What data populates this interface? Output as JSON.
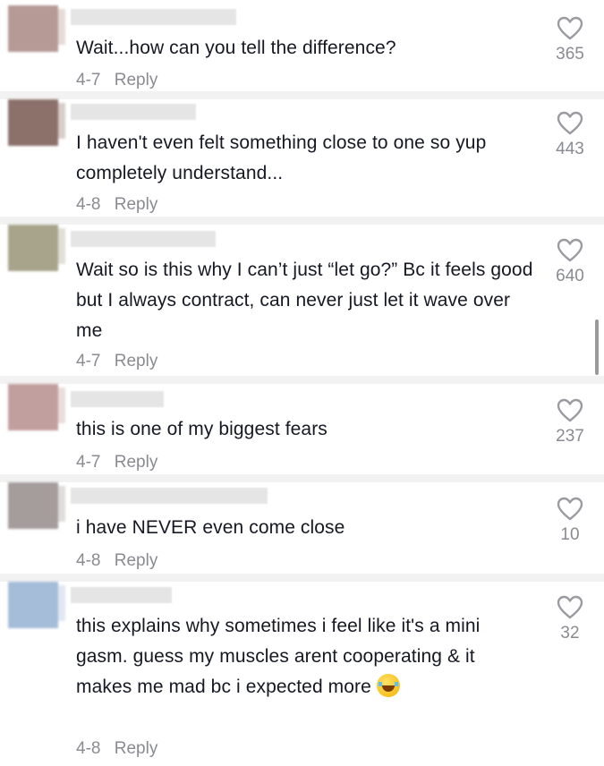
{
  "comments": [
    {
      "avatar_color": "#b59a96",
      "text": "Wait...how can you tell the difference?",
      "date": "4-7",
      "reply_label": "Reply",
      "likes": "365"
    },
    {
      "avatar_color": "#8c716b",
      "text": "I haven't even felt something close to one so yup completely understand...",
      "date": "4-8",
      "reply_label": "Reply",
      "likes": "443"
    },
    {
      "avatar_color": "#a8a48c",
      "text": "Wait so is this why I can’t just “let go?” Bc it feels good but I always contract, can never just let it wave over me",
      "date": "4-7",
      "reply_label": "Reply",
      "likes": "640"
    },
    {
      "avatar_color": "#c29f9f",
      "text": "this is one of my biggest fears",
      "date": "4-7",
      "reply_label": "Reply",
      "likes": "237"
    },
    {
      "avatar_color": "#a59c9c",
      "text": "i have NEVER even come close",
      "date": "4-8",
      "reply_label": "Reply",
      "likes": "10"
    },
    {
      "avatar_color": "#a5bdd8",
      "text": "this explains why sometimes i feel like it's a mini gasm. guess my muscles arent cooperating & it makes me mad bc i expected more",
      "emoji": "laughing-tears-emoji",
      "date": "4-8",
      "reply_label": "Reply",
      "likes": "32"
    }
  ]
}
